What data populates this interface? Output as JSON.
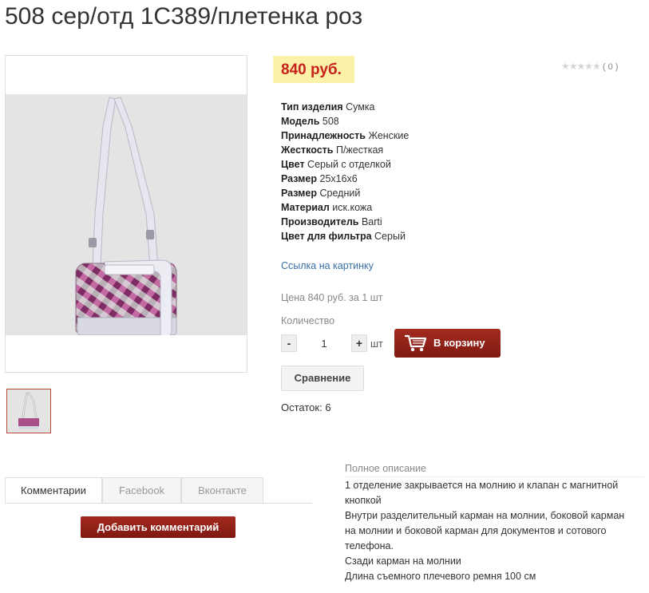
{
  "product": {
    "title": "508 сер/отд 1С389/плетенка роз",
    "price": "840 руб.",
    "rating_count": "( 0 )",
    "stars": "★★★★★"
  },
  "specs": [
    {
      "label": "Тип изделия",
      "value": "Сумка"
    },
    {
      "label": "Модель",
      "value": "508"
    },
    {
      "label": "Принадлежность",
      "value": "Женские"
    },
    {
      "label": "Жесткость",
      "value": "П/жесткая"
    },
    {
      "label": "Цвет",
      "value": "Серый с отделкой"
    },
    {
      "label": "Размер",
      "value": "25x16x6"
    },
    {
      "label": "Размер",
      "value": "Средний"
    },
    {
      "label": "Материал",
      "value": "иск.кожа"
    },
    {
      "label": "Производитель",
      "value": "Barti"
    },
    {
      "label": "Цвет для фильтра",
      "value": "Серый"
    }
  ],
  "link_label": "Ссылка на картинку",
  "unit_price": "Цена 840 руб. за 1 шт",
  "quantity": {
    "label": "Количество",
    "minus": "-",
    "plus": "+",
    "value": "1",
    "unit": "шт"
  },
  "cart_button": "В корзину",
  "compare_button": "Сравнение",
  "stock": "Остаток: 6",
  "tabs": [
    {
      "label": "Комментарии",
      "active": true
    },
    {
      "label": "Facebook",
      "active": false
    },
    {
      "label": "Вконтакте",
      "active": false
    }
  ],
  "add_comment_button": "Добавить комментарий",
  "description": {
    "title": "Полное описание",
    "lines": [
      "1 отделение закрывается на молнию и клапан с магнитной",
      "кнопкой",
      "Внутри разделительный карман на молнии, боковой карман",
      "на молнии и боковой карман для документов и сотового",
      "телефона.",
      "Сзади карман на молнии",
      "Длина съемного плечевого ремня 100 см"
    ]
  },
  "colors": {
    "price": "#c9211e",
    "price_bg": "#fbf2a8",
    "button": "#8c1f15",
    "link": "#3a6ea5"
  }
}
